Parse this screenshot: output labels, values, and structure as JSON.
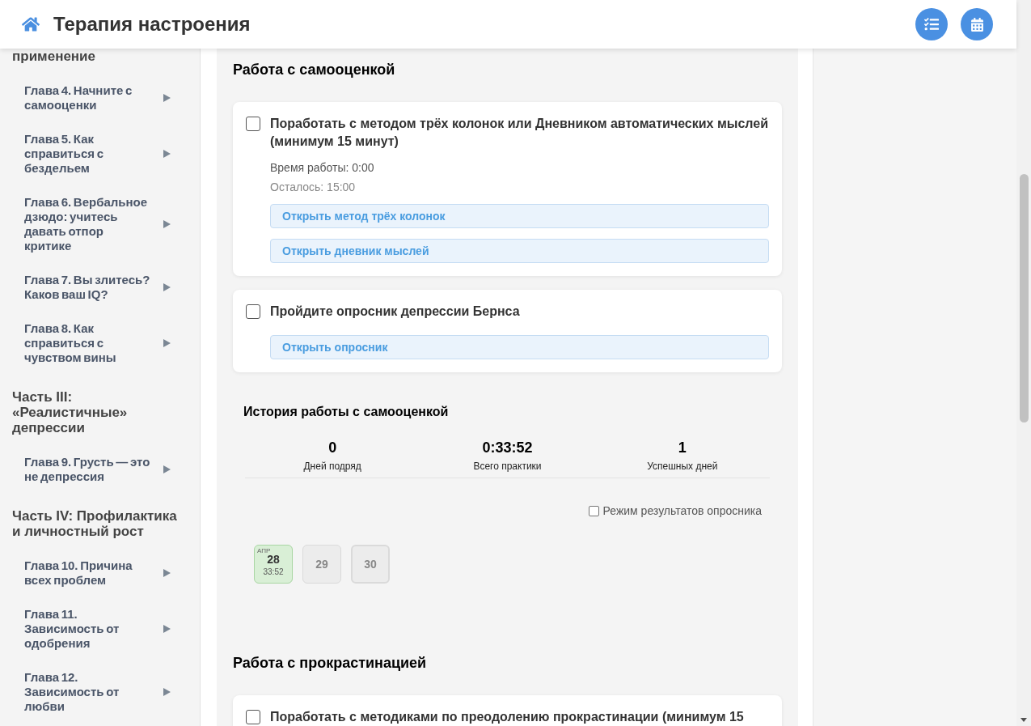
{
  "header": {
    "title": "Терапия настроения"
  },
  "sidebar": {
    "items": [
      {
        "label": "применение",
        "children": [
          {
            "label": "Глава 4. Начните с самооценки"
          },
          {
            "label": "Глава 5. Как справиться с бездельем"
          },
          {
            "label": "Глава 6. Вербальное дзюдо: учитесь давать отпор критике"
          },
          {
            "label": "Глава 7. Вы злитесь? Каков ваш IQ?"
          },
          {
            "label": "Глава 8. Как справиться с чувством вины"
          }
        ]
      },
      {
        "label": "Часть III: «Реалистичные» депрессии",
        "children": [
          {
            "label": "Глава 9. Грусть — это не депрессия"
          }
        ]
      },
      {
        "label": "Часть IV: Профилактика и личностный рост",
        "children": [
          {
            "label": "Глава 10. Причина всех проблем"
          },
          {
            "label": "Глава 11. Зависимость от одобрения"
          },
          {
            "label": "Глава 12. Зависимость от любви"
          }
        ]
      }
    ]
  },
  "sections": [
    {
      "title": "Работа с самооценкой",
      "tasks": [
        {
          "checked": false,
          "text": "Поработать с методом трёх колонок или Дневником автоматических мыслей (минимум 15 минут)",
          "details": [
            {
              "kind": "elapsed",
              "text": "Время работы: 0:00"
            },
            {
              "kind": "remaining",
              "text": "Осталось: 15:00"
            }
          ],
          "links": [
            "Открыть метод трёх колонок",
            "Открыть дневник мыслей"
          ]
        },
        {
          "checked": false,
          "text": "Пройдите опросник депрессии Бернса",
          "links": [
            "Открыть опросник"
          ]
        }
      ],
      "history": {
        "title": "История работы с самооценкой",
        "stats": [
          {
            "value": "0",
            "label": "Дней подряд"
          },
          {
            "value": "0:33:52",
            "label": "Всего практики"
          },
          {
            "value": "1",
            "label": "Успешных дней"
          }
        ],
        "quiz_mode": {
          "label": "Режим результатов опросника",
          "checked": false
        },
        "days": [
          {
            "kind": "done",
            "month": "АПР",
            "day": "28",
            "time": "33:52",
            "today": false
          },
          {
            "kind": "empty",
            "day": "29",
            "today": false
          },
          {
            "kind": "empty",
            "day": "30",
            "today": true
          }
        ]
      }
    },
    {
      "title": "Работа с прокрастинацией",
      "tasks": [
        {
          "checked": false,
          "text": "Поработать с методиками по преодолению прокрастинации (минимум 15"
        }
      ]
    }
  ]
}
